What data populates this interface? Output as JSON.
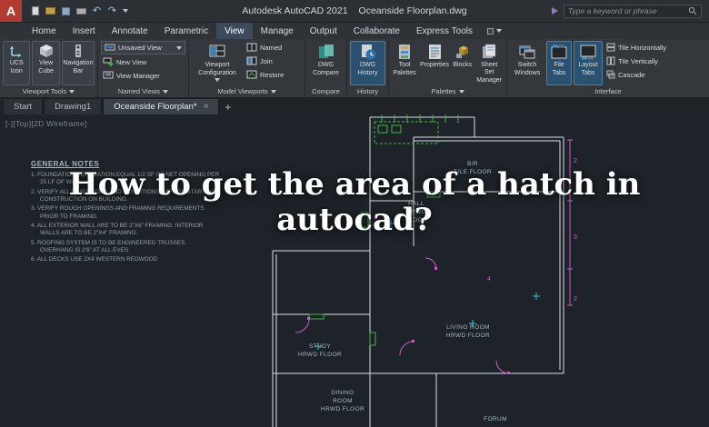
{
  "titlebar": {
    "logo_letter": "A",
    "app_title": "Autodesk AutoCAD 2021",
    "doc_title": "Oceanside Floorplan.dwg",
    "search_placeholder": "Type a keyword or phrase"
  },
  "icons": {
    "undo": "↶",
    "redo": "↷",
    "close": "×"
  },
  "ribbon_tabs": {
    "active": "View",
    "items": [
      {
        "label": "Home"
      },
      {
        "label": "Insert"
      },
      {
        "label": "Annotate"
      },
      {
        "label": "Parametric"
      },
      {
        "label": "View"
      },
      {
        "label": "Manage"
      },
      {
        "label": "Output"
      },
      {
        "label": "Collaborate"
      },
      {
        "label": "Express Tools"
      }
    ]
  },
  "panels": {
    "viewport_tools": {
      "label": "Viewport Tools",
      "ucs": {
        "line1": "UCS",
        "line2": "Icon"
      },
      "viewcube": {
        "line1": "View",
        "line2": "Cube"
      },
      "navbar": {
        "line1": "Navigation",
        "line2": "Bar"
      }
    },
    "named_views": {
      "label": "Named Views",
      "current_view": "Unsaved View",
      "new_view": "New View",
      "view_manager": "View Manager"
    },
    "model_viewports": {
      "label": "Model Viewports",
      "config": {
        "line1": "Viewport",
        "line2": "Configuration"
      },
      "named": "Named",
      "join": "Join",
      "restore": "Restore"
    },
    "compare": {
      "label": "Compare",
      "button": {
        "line1": "DWG",
        "line2": "Compare"
      }
    },
    "history": {
      "label": "History",
      "button": {
        "line1": "DWG",
        "line2": "History"
      }
    },
    "palettes": {
      "label": "Palettes",
      "tool_palettes": {
        "line1": "Tool",
        "line2": "Palettes"
      },
      "properties": "Properties",
      "blocks": "Blocks",
      "sheet_set": {
        "line1": "Sheet Set",
        "line2": "Manager"
      }
    },
    "interface": {
      "label": "Interface",
      "switch_windows": {
        "line1": "Switch",
        "line2": "Windows"
      },
      "file_tabs": {
        "line1": "File",
        "line2": "Tabs"
      },
      "layout_tabs": {
        "line1": "Layout",
        "line2": "Tabs"
      },
      "tile_horizontally": "Tile Horizontally",
      "tile_vertically": "Tile Vertically",
      "cascade": "Cascade"
    }
  },
  "file_tabs": {
    "active": "Oceanside Floorplan*",
    "new_tab_label": "+",
    "items": [
      {
        "label": "Start"
      },
      {
        "label": "Drawing1"
      },
      {
        "label": "Oceanside Floorplan*"
      }
    ]
  },
  "canvas": {
    "viewport_label": "[-][Top][2D Wireframe]",
    "notes_title": "GENERAL NOTES",
    "notes": [
      "1.  FOUNDATION VENTILATION EQUAL 1/2 SF OF NET OPENING PER 25 LF OF WALL.",
      "2.  VERIFY ALL DIMENSIONS AND CONDITIONS BEFORE STARTING CONSTRUCTION ON BUILDING.",
      "3.  VERIFY ROUGH OPENINGS AND FRAMING REQUIREMENTS PRIOR TO FRAMING.",
      "4.  ALL EXTERIOR WALL ARE TO BE 2\"X6\" FRAMING. INTERIOR WALLS ARE TO BE 2\"X4\" FRAMING.",
      "5.  ROOFING SYSTEM IS TO BE ENGINEERED TRUSSES. OVERHANG IS 2'6\" AT ALL EVES.",
      "6.  ALL DECKS USE 2X4 WESTERN REDWOOD"
    ],
    "rooms": [
      {
        "text": "B/R\nTILE FLOOR"
      },
      {
        "text": "HALL\nHRWD\nFLOOR"
      },
      {
        "text": "LIVING ROOM\nHRWD FLOOR"
      },
      {
        "text": "STUDY\nHRWD FLOOR"
      },
      {
        "text": "DINING\nROOM\nHRWD FLOOR"
      },
      {
        "text": "FORUM"
      }
    ],
    "dims": [
      "2",
      "3",
      "2",
      "4"
    ]
  },
  "overlay": {
    "question": "How to get the area of a hatch in autocad?"
  }
}
